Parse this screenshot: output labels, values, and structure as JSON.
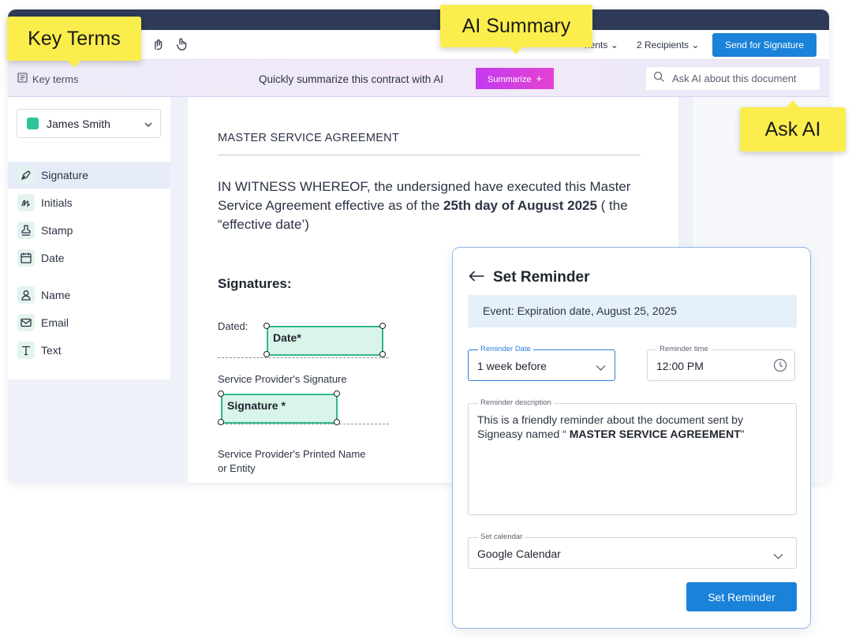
{
  "toolbar": {
    "documents_label": "nents",
    "recipients_label": "2 Recipients",
    "send_button": "Send for Signature"
  },
  "ai_bar": {
    "key_terms_label": "Key terms",
    "prompt_text": "Quickly summarize this contract with AI",
    "summarize_button": "Summarize",
    "ask_ai_placeholder": "Ask AI about this document"
  },
  "sidebar": {
    "signer": {
      "name": "James Smith",
      "color": "#2fc399"
    },
    "fields": [
      {
        "label": "Signature",
        "icon": "pen-nib-icon"
      },
      {
        "label": "Initials",
        "icon": "initials-icon"
      },
      {
        "label": "Stamp",
        "icon": "stamp-icon"
      },
      {
        "label": "Date",
        "icon": "calendar-icon"
      },
      {
        "label": "Name",
        "icon": "person-icon"
      },
      {
        "label": "Email",
        "icon": "envelope-icon"
      },
      {
        "label": "Text",
        "icon": "text-t-icon"
      }
    ]
  },
  "document": {
    "title": "MASTER SERVICE AGREEMENT",
    "paragraph_start": "IN WITNESS WHEREOF, the undersigned have executed this Master Service Agreement effective as of the ",
    "paragraph_bold": "25th day of August 2025",
    "paragraph_end": " ( the “effective date’)",
    "signatures_heading": "Signatures:",
    "dated_label": "Dated:",
    "date_field": "Date*",
    "provider_signature_label": "Service Provider's Signature",
    "signature_field": "Signature *",
    "printed_name_label_line1": "Service Provider's Printed Name",
    "printed_name_label_line2": "or Entity"
  },
  "reminder": {
    "title": "Set Reminder",
    "event": "Event: Expiration date, August 25, 2025",
    "reminder_date_label": "Reminder Date",
    "reminder_date_value": "1 week before",
    "reminder_time_label": "Reminder time",
    "reminder_time_value": "12:00 PM",
    "description_label": "Reminder description",
    "description_start": "This is a friendly reminder about the document sent by Signeasy named “ ",
    "description_bold": "MASTER SERVICE AGREEMENT",
    "description_end": "”",
    "calendar_label": "Set calendar",
    "calendar_value": "Google Calendar",
    "button": "Set Reminder"
  },
  "callouts": {
    "key_terms": "Key Terms",
    "ai_summary": "AI Summary",
    "ask_ai": "Ask AI"
  },
  "colors": {
    "accent_blue": "#1a82d8",
    "summarize_gradient": [
      "#c23cf0",
      "#e442d0"
    ],
    "field_green": "#2fb88b",
    "callout_yellow": "#fbee4c",
    "header_navy": "#2e3a57"
  }
}
